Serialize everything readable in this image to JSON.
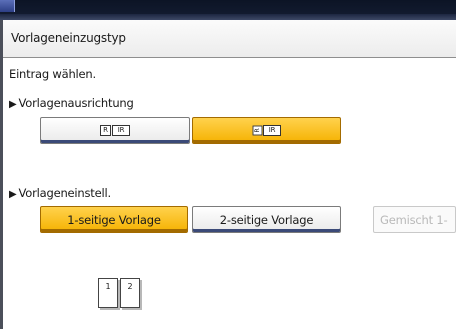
{
  "header": {
    "title": "Vorlageneinzugstyp"
  },
  "prompt": "Eintrag wählen.",
  "orientation": {
    "label": "Vorlagenausrichtung",
    "options": [
      {
        "left_glyph": "R",
        "right_glyph": "IR",
        "selected": false
      },
      {
        "left_glyph": "R",
        "right_glyph": "IR",
        "selected": true
      }
    ]
  },
  "setting": {
    "label": "Vorlageneinstell.",
    "options": [
      {
        "label": "1-seitige Vorlage",
        "selected": true
      },
      {
        "label": "2-seitige Vorlage",
        "selected": false
      },
      {
        "label": "Gemischt 1-",
        "selected": false,
        "disabled": true
      }
    ]
  },
  "preview": {
    "pages": [
      "1",
      "2"
    ]
  },
  "colors": {
    "selected": "#f5b100",
    "bezel": "#0c1425",
    "disabled_text": "#b9b9b9"
  },
  "icons": {
    "section_marker": "right-triangle-icon"
  }
}
